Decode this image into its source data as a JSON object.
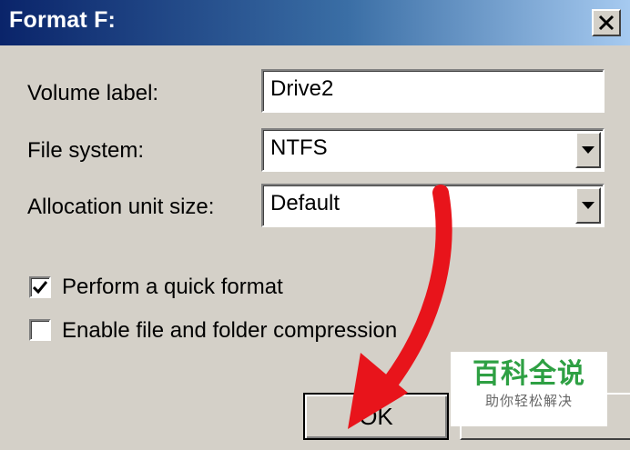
{
  "window": {
    "title": "Format F:",
    "close_icon": "close-icon"
  },
  "form": {
    "volume_label": {
      "label": "Volume label:",
      "value": "Drive2"
    },
    "file_system": {
      "label": "File system:",
      "value": "NTFS"
    },
    "allocation": {
      "label": "Allocation unit size:",
      "value": "Default"
    }
  },
  "options": {
    "quick_format": {
      "label": "Perform a quick format",
      "checked": true
    },
    "compression": {
      "label": "Enable file and folder compression",
      "checked": false
    }
  },
  "buttons": {
    "ok": "OK"
  },
  "watermark": {
    "main": "百科全说",
    "sub": "助你轻松解决"
  },
  "colors": {
    "titlebar_start": "#0a246a",
    "titlebar_end": "#a6caf0",
    "dialog_bg": "#d4d0c8",
    "arrow": "#e8141b",
    "watermark_text": "#2ea043"
  }
}
